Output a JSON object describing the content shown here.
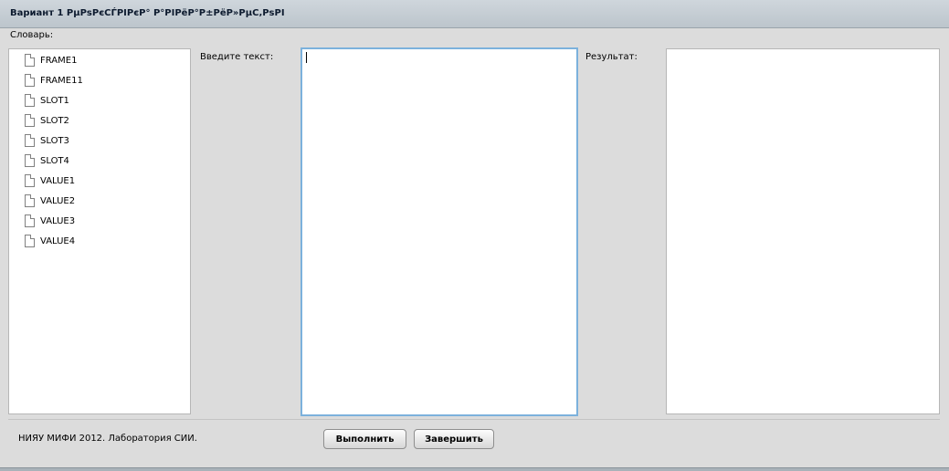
{
  "window": {
    "title": "Вариант 1 РµРѕРєСЃРІРєР° Р°РІРёР°Р±РёР»РµС‚РѕРІ"
  },
  "dictionary": {
    "label": "Словарь:",
    "items": [
      {
        "label": "FRAME1",
        "icon": "file-icon"
      },
      {
        "label": "FRAME11",
        "icon": "file-icon"
      },
      {
        "label": "SLOT1",
        "icon": "file-icon"
      },
      {
        "label": "SLOT2",
        "icon": "file-icon"
      },
      {
        "label": "SLOT3",
        "icon": "file-icon"
      },
      {
        "label": "SLOT4",
        "icon": "file-icon"
      },
      {
        "label": "VALUE1",
        "icon": "file-icon"
      },
      {
        "label": "VALUE2",
        "icon": "file-icon"
      },
      {
        "label": "VALUE3",
        "icon": "file-icon"
      },
      {
        "label": "VALUE4",
        "icon": "file-icon"
      }
    ]
  },
  "input": {
    "label": "Введите текст:",
    "value": ""
  },
  "result": {
    "label": "Результат:",
    "value": ""
  },
  "footer": {
    "text": "НИЯУ МИФИ 2012. Лаборатория СИИ.",
    "run_button": "Выполнить",
    "exit_button": "Завершить"
  },
  "colors": {
    "input_focus_border": "#7cb1dc",
    "window_background": "#dcdcdc",
    "titlebar": "#c5cdd3"
  }
}
